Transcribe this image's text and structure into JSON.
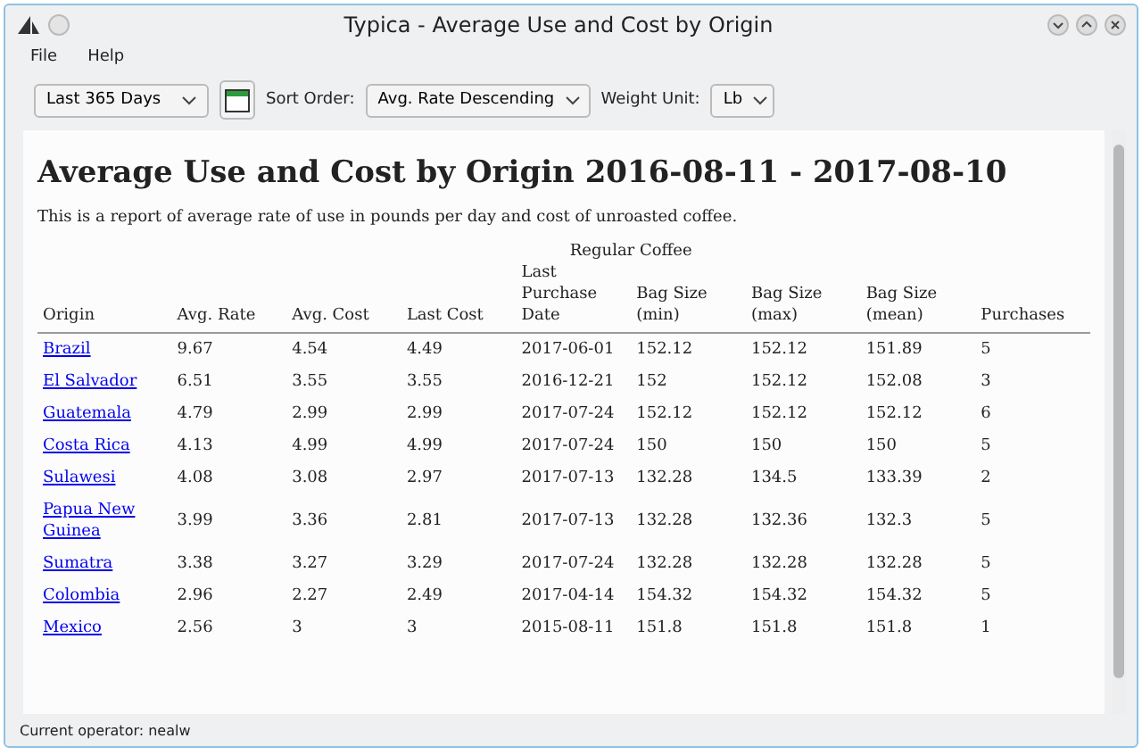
{
  "window": {
    "title": "Typica - Average Use and Cost by Origin"
  },
  "menu": [
    "File",
    "Help"
  ],
  "toolbar": {
    "range": "Last 365 Days",
    "sort_label": "Sort Order:",
    "sort": "Avg. Rate Descending",
    "unit_label": "Weight Unit:",
    "unit": "Lb"
  },
  "report": {
    "title": "Average Use and Cost by Origin 2016-08-11 - 2017-08-10",
    "description": "This is a report of average rate of use in pounds per day and cost of unroasted coffee.",
    "group_header": "Regular Coffee",
    "columns": [
      "Origin",
      "Avg. Rate",
      "Avg. Cost",
      "Last Cost",
      "Last Purchase Date",
      "Bag Size (min)",
      "Bag Size (max)",
      "Bag Size (mean)",
      "Purchases"
    ],
    "rows": [
      [
        "Brazil",
        "9.67",
        "4.54",
        "4.49",
        "2017-06-01",
        "152.12",
        "152.12",
        "151.89",
        "5"
      ],
      [
        "El Salvador",
        "6.51",
        "3.55",
        "3.55",
        "2016-12-21",
        "152",
        "152.12",
        "152.08",
        "3"
      ],
      [
        "Guatemala",
        "4.79",
        "2.99",
        "2.99",
        "2017-07-24",
        "152.12",
        "152.12",
        "152.12",
        "6"
      ],
      [
        "Costa Rica",
        "4.13",
        "4.99",
        "4.99",
        "2017-07-24",
        "150",
        "150",
        "150",
        "5"
      ],
      [
        "Sulawesi",
        "4.08",
        "3.08",
        "2.97",
        "2017-07-13",
        "132.28",
        "134.5",
        "133.39",
        "2"
      ],
      [
        "Papua New Guinea",
        "3.99",
        "3.36",
        "2.81",
        "2017-07-13",
        "132.28",
        "132.36",
        "132.3",
        "5"
      ],
      [
        "Sumatra",
        "3.38",
        "3.27",
        "3.29",
        "2017-07-24",
        "132.28",
        "132.28",
        "132.28",
        "5"
      ],
      [
        "Colombia",
        "2.96",
        "2.27",
        "2.49",
        "2017-04-14",
        "154.32",
        "154.32",
        "154.32",
        "5"
      ],
      [
        "Mexico",
        "2.56",
        "3",
        "3",
        "2015-08-11",
        "151.8",
        "151.8",
        "151.8",
        "1"
      ]
    ]
  },
  "status_bar": "Current operator: nealw"
}
